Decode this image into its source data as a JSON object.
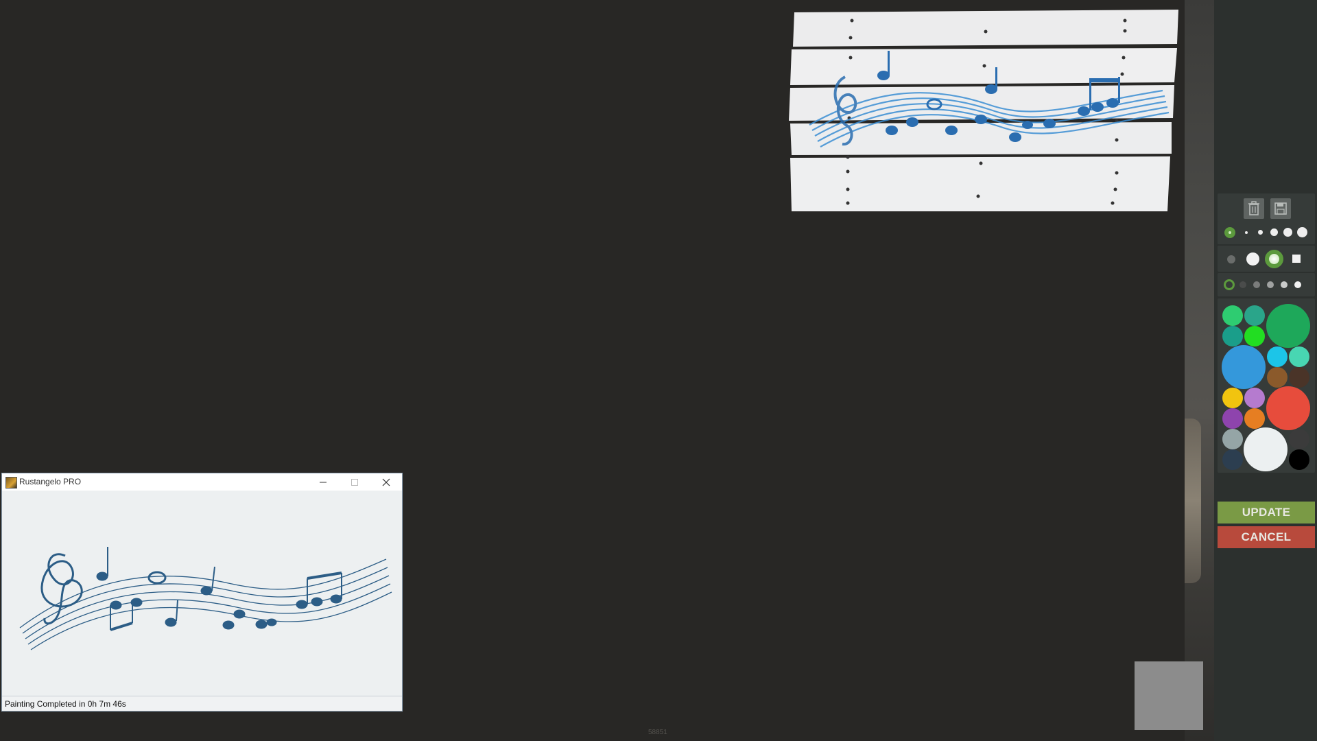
{
  "app": {
    "title": "Rustangelo PRO",
    "status": "Painting Completed in 0h 7m 46s"
  },
  "toolbar": {
    "trash_icon": "trash-icon",
    "save_icon": "floppy-disk-icon"
  },
  "actions": {
    "update_label": "UPDATE",
    "cancel_label": "CANCEL",
    "update_color": "#7a9a45",
    "cancel_color": "#b84a3c"
  },
  "palette": {
    "colors": [
      "#2ecc71",
      "#2aa58a",
      "#1a9e8a",
      "#22dd22",
      "#1ea85a",
      "#3498db",
      "#1cc5e8",
      "#48d6b2",
      "#8b5a2b",
      "#4a3428",
      "#f1c40f",
      "#b57bcf",
      "#8e44ad",
      "#e67e22",
      "#e74c3c",
      "#95a5a6",
      "#ecf0f1",
      "#2c3e50",
      "#3b3b3b",
      "#000000"
    ]
  },
  "footer": {
    "version_number": "58851"
  }
}
